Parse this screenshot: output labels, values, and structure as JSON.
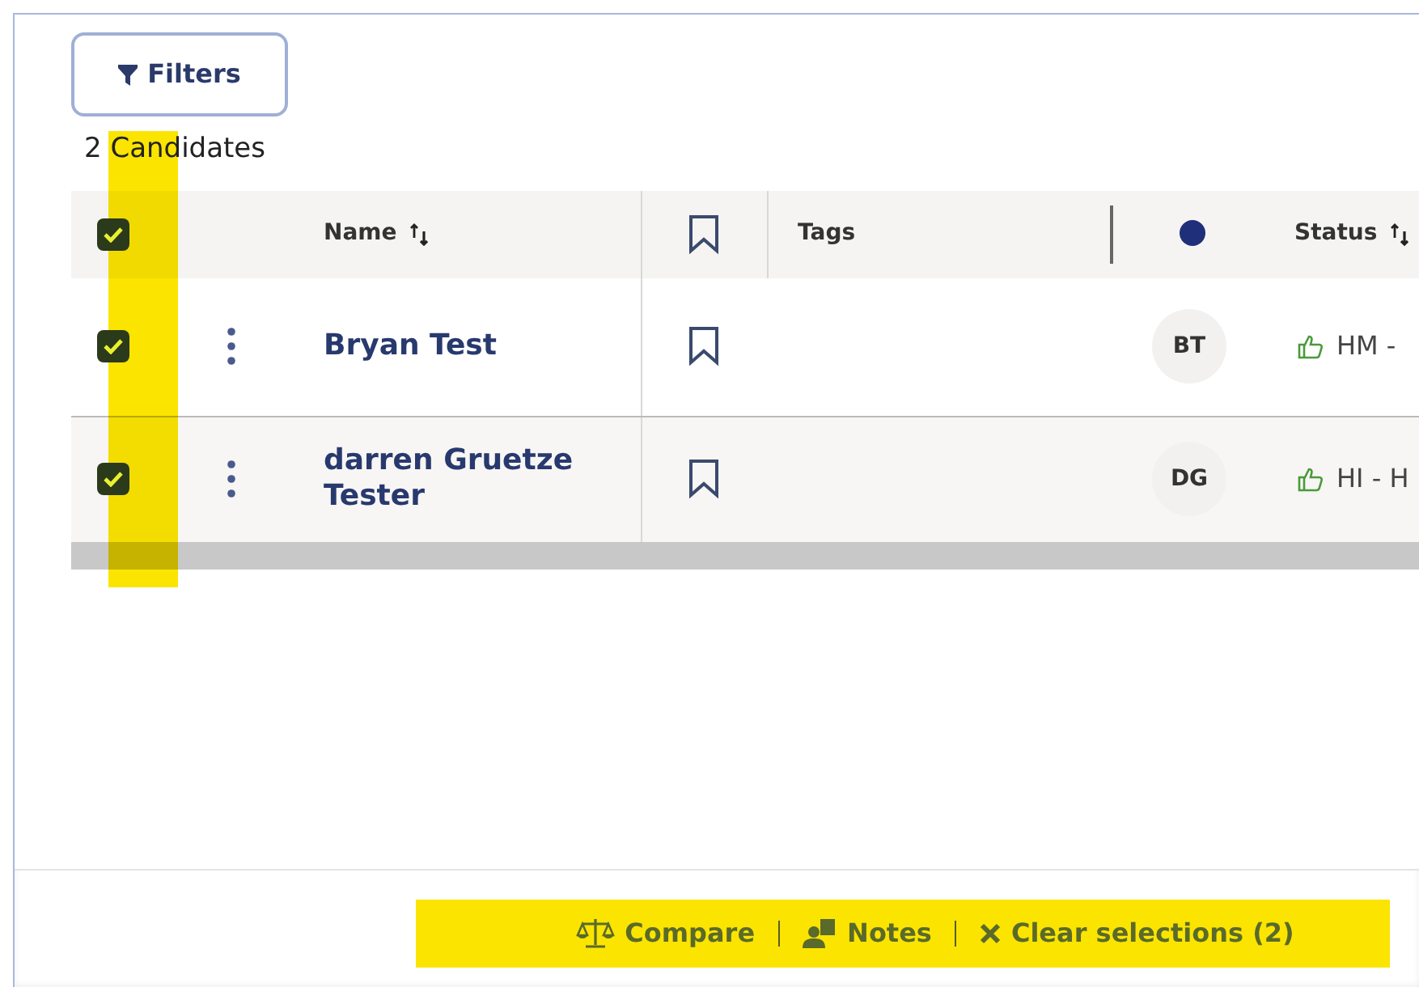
{
  "filters_button": {
    "label": "Filters"
  },
  "result_count": "2 Candidates",
  "table": {
    "select_all_checked": true,
    "columns": [
      {
        "kind": "select"
      },
      {
        "kind": "menu"
      },
      {
        "kind": "text",
        "label": "Name",
        "sortable": true
      },
      {
        "kind": "bookmark"
      },
      {
        "kind": "text",
        "label": "Tags",
        "sortable": false
      },
      {
        "kind": "dot"
      },
      {
        "kind": "text",
        "label": "Status",
        "sortable": true
      }
    ],
    "rows": [
      {
        "checked": true,
        "name": "Bryan Test",
        "initials": "BT",
        "status": "HM -"
      },
      {
        "checked": true,
        "name": "darren Gruetze Tester",
        "initials": "DG",
        "status": "HI - H"
      }
    ]
  },
  "actions": [
    {
      "kind": "compare",
      "label": "Compare"
    },
    {
      "kind": "notes",
      "label": "Notes"
    },
    {
      "kind": "clear",
      "label": "Clear selections (2)"
    }
  ]
}
